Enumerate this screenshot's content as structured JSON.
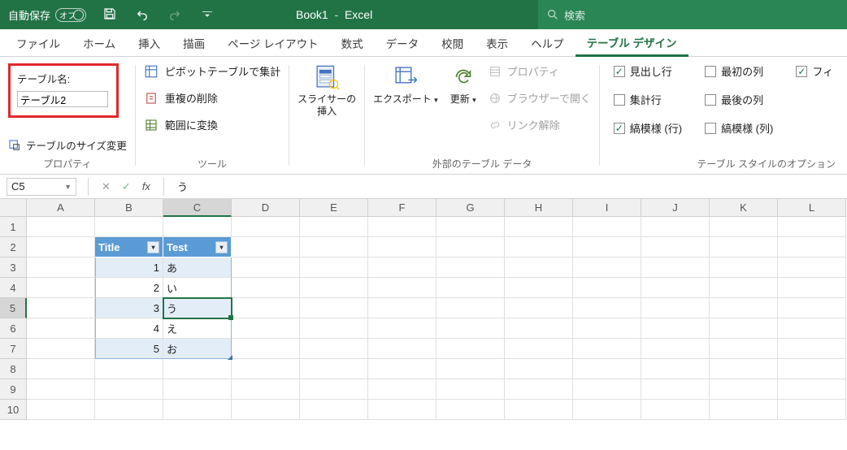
{
  "titlebar": {
    "autosave_label": "自動保存",
    "autosave_state": "オフ",
    "doc_name": "Book1",
    "app_name": "Excel",
    "search_placeholder": "検索"
  },
  "tabs": [
    "ファイル",
    "ホーム",
    "挿入",
    "描画",
    "ページ レイアウト",
    "数式",
    "データ",
    "校閲",
    "表示",
    "ヘルプ",
    "テーブル デザイン"
  ],
  "active_tab": 10,
  "ribbon": {
    "table_name_label": "テーブル名:",
    "table_name_value": "テーブル2",
    "resize_label": "テーブルのサイズ変更",
    "group1_label": "プロパティ",
    "pivot_label": "ピボットテーブルで集計",
    "dedup_label": "重複の削除",
    "range_label": "範囲に変換",
    "group2_label": "ツール",
    "slicer_label": "スライサーの\n挿入",
    "export_label": "エクスポート",
    "refresh_label": "更新",
    "prop_label": "プロパティ",
    "browser_label": "ブラウザーで開く",
    "unlink_label": "リンク解除",
    "group3_label": "外部のテーブル データ",
    "checks": {
      "header_row": "見出し行",
      "total_row": "集計行",
      "band_row": "縞模様 (行)",
      "first_col": "最初の列",
      "last_col": "最後の列",
      "band_col": "縞模様 (列)",
      "filter_btn": "フィ"
    },
    "group4_label": "テーブル スタイルのオプション"
  },
  "formula_bar": {
    "name_box": "C5",
    "fx": "fx",
    "content": "う"
  },
  "columns": [
    "A",
    "B",
    "C",
    "D",
    "E",
    "F",
    "G",
    "H",
    "I",
    "J",
    "K",
    "L"
  ],
  "selected_col": 2,
  "rows": [
    1,
    2,
    3,
    4,
    5,
    6,
    7,
    8,
    9,
    10
  ],
  "selected_row": 4,
  "table": {
    "headers": [
      "Title",
      "Test"
    ],
    "data": [
      {
        "title": 1,
        "test": "あ"
      },
      {
        "title": 2,
        "test": "い"
      },
      {
        "title": 3,
        "test": "う"
      },
      {
        "title": 4,
        "test": "え"
      },
      {
        "title": 5,
        "test": "お"
      }
    ]
  }
}
